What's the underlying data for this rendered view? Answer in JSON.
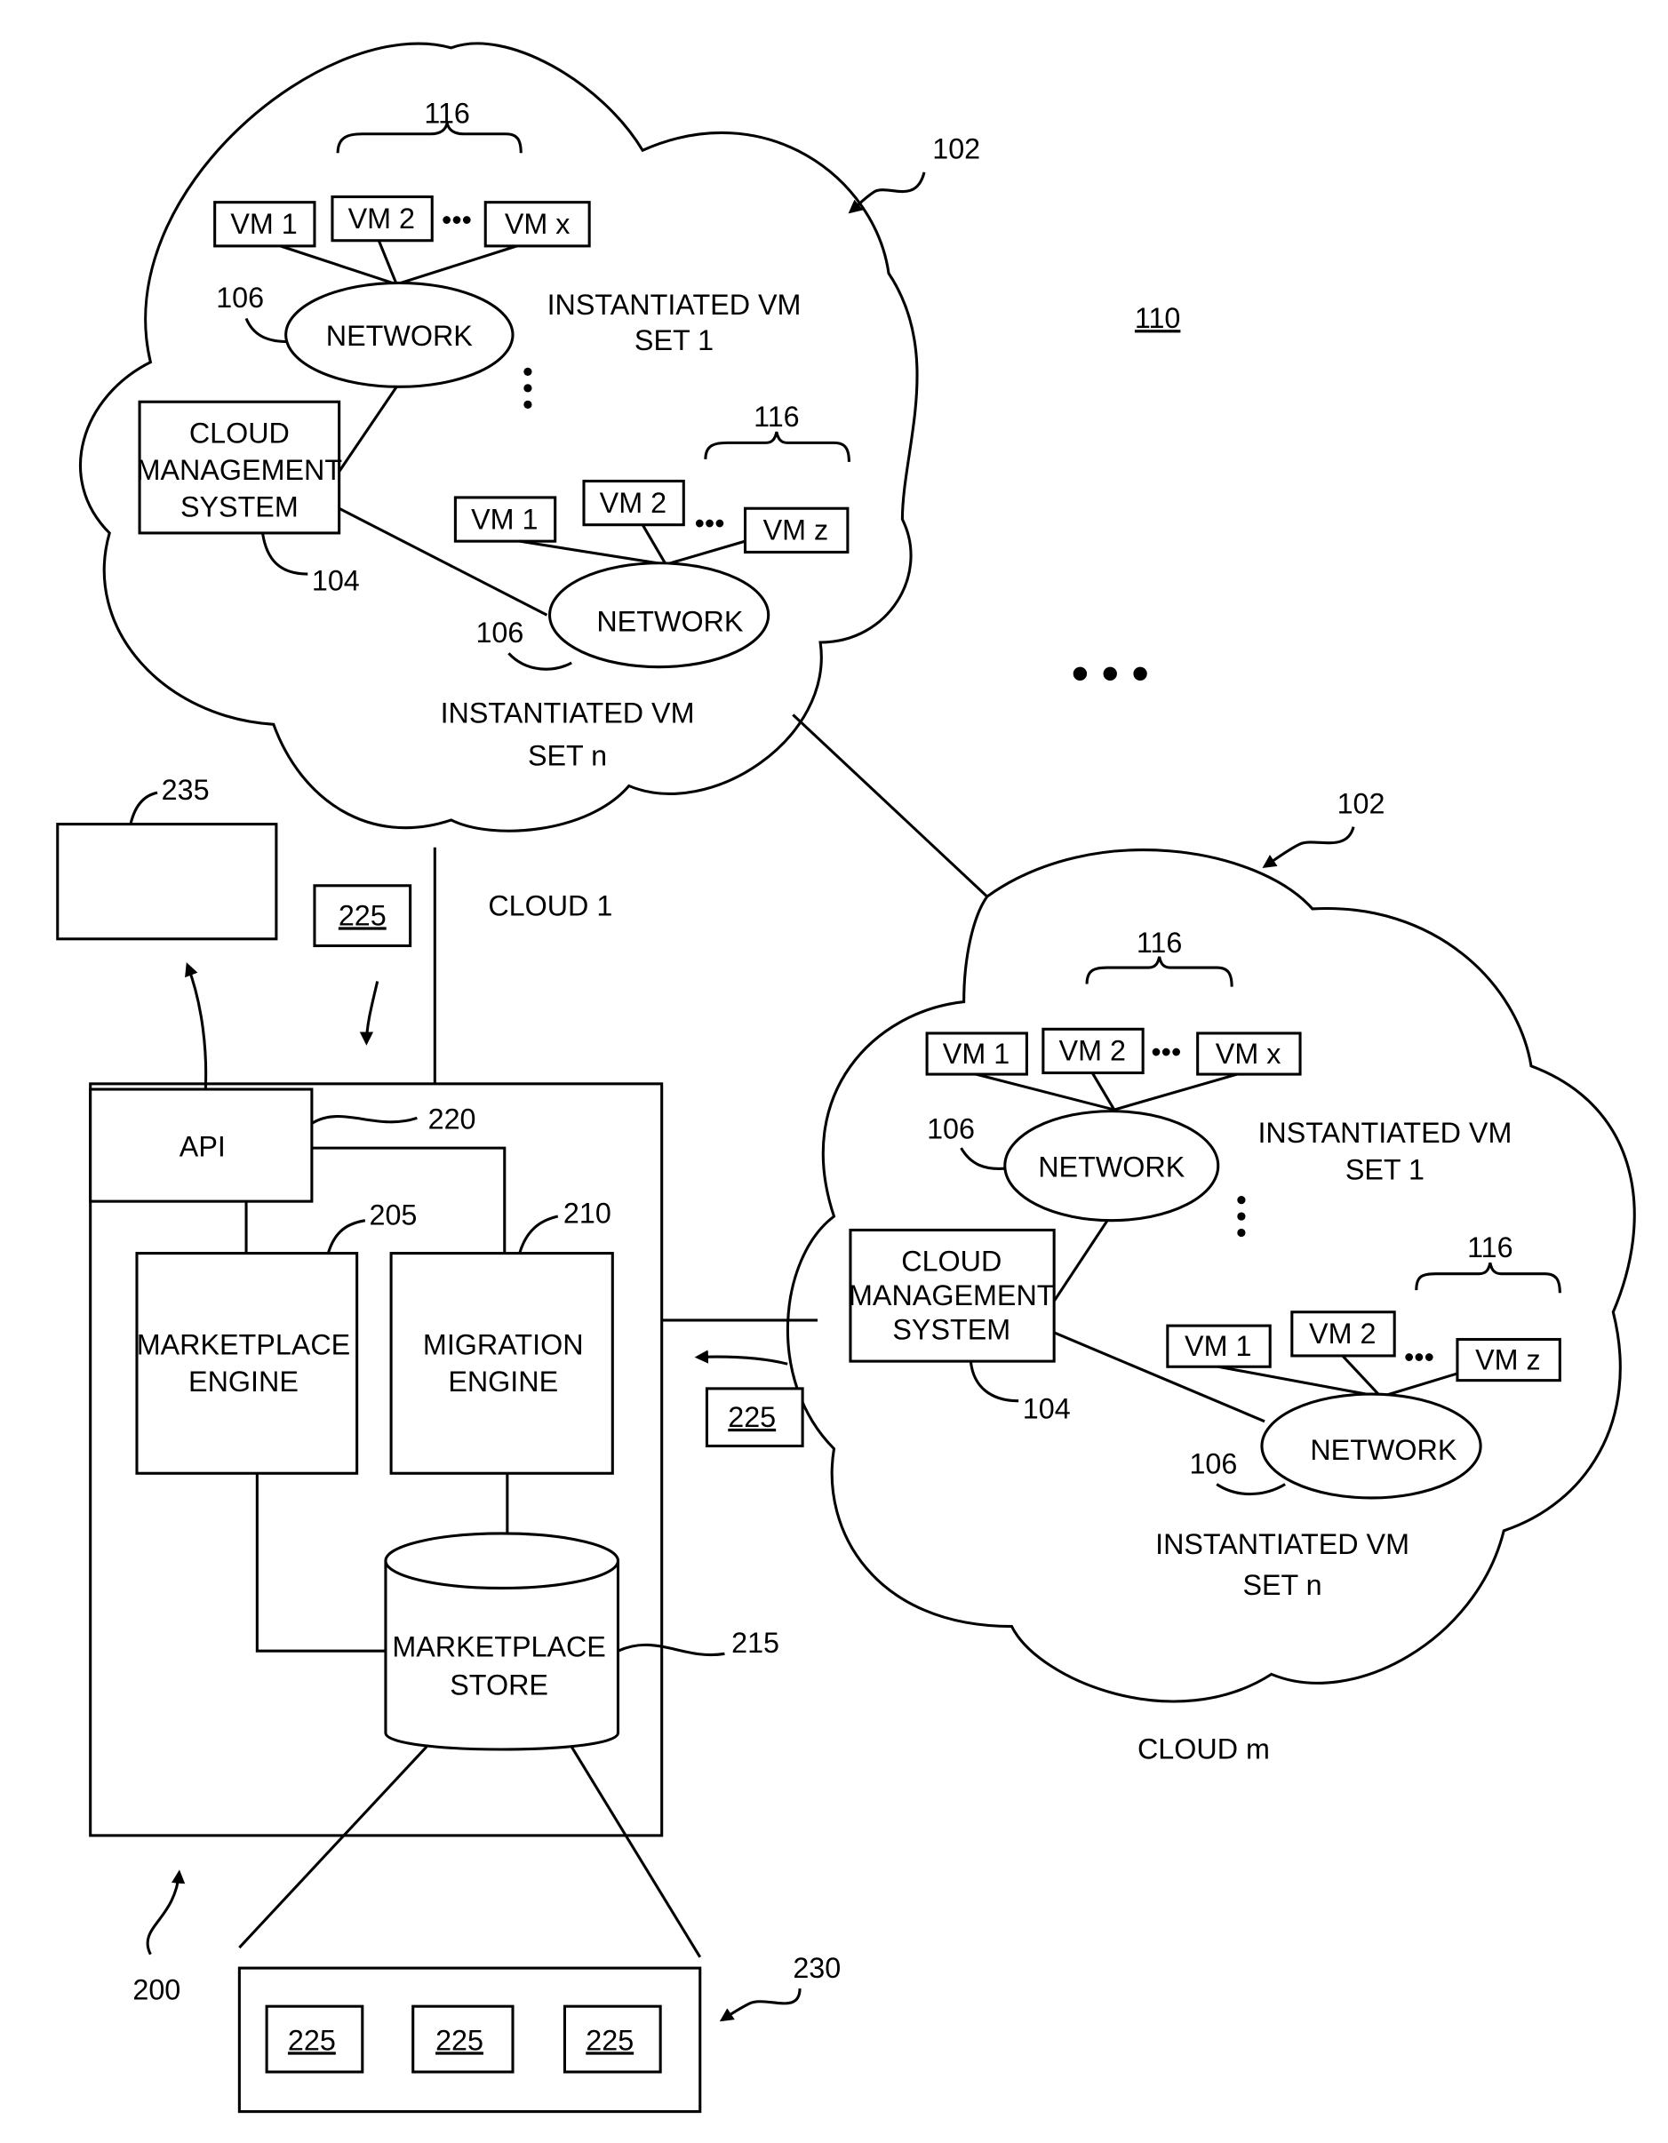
{
  "figure": {
    "system_ref": "110",
    "ellipsis": "•••"
  },
  "cloud_1": {
    "label": "CLOUD 1",
    "ref": "102",
    "set1": {
      "vm_group_ref": "116",
      "vms": [
        "VM 1",
        "VM 2",
        "VM x"
      ],
      "network_label": "NETWORK",
      "network_ref": "106",
      "set_label_line1": "INSTANTIATED VM",
      "set_label_line2": "SET 1"
    },
    "setn": {
      "vm_group_ref": "116",
      "vms": [
        "VM 1",
        "VM 2",
        "VM z"
      ],
      "network_label": "NETWORK",
      "network_ref": "106",
      "set_label_line1": "INSTANTIATED VM",
      "set_label_line2": "SET n"
    },
    "cms": {
      "line1": "CLOUD",
      "line2": "MANAGEMENT",
      "line3": "SYSTEM",
      "ref": "104"
    }
  },
  "cloud_m": {
    "label": "CLOUD m",
    "ref": "102",
    "set1": {
      "vm_group_ref": "116",
      "vms": [
        "VM 1",
        "VM 2",
        "VM x"
      ],
      "network_label": "NETWORK",
      "network_ref": "106",
      "set_label_line1": "INSTANTIATED VM",
      "set_label_line2": "SET 1"
    },
    "setn": {
      "vm_group_ref": "116",
      "vms": [
        "VM 1",
        "VM 2",
        "VM z"
      ],
      "network_label": "NETWORK",
      "network_ref": "106",
      "set_label_line1": "INSTANTIATED VM",
      "set_label_line2": "SET n"
    },
    "cms": {
      "line1": "CLOUD",
      "line2": "MANAGEMENT",
      "line3": "SYSTEM",
      "ref": "104"
    }
  },
  "marketplace_system": {
    "ref": "200",
    "api": {
      "label": "API",
      "ref": "220"
    },
    "marketplace_engine": {
      "line1": "MARKETPLACE",
      "line2": "ENGINE",
      "ref": "205"
    },
    "migration_engine": {
      "line1": "MIGRATION",
      "line2": "ENGINE",
      "ref": "210"
    },
    "marketplace_store": {
      "line1": "MARKETPLACE",
      "line2": "STORE",
      "ref": "215"
    }
  },
  "external_box": {
    "ref": "235"
  },
  "vm_image_ref": "225",
  "image_collection": {
    "ref": "230",
    "items": [
      "225",
      "225",
      "225"
    ]
  }
}
